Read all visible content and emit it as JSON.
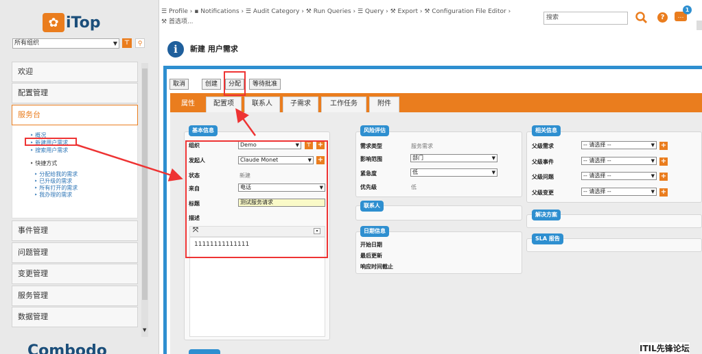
{
  "app": {
    "logo_text": "iTop",
    "vendor_text": "Combodo"
  },
  "left": {
    "org_select": "所有组织",
    "menus": [
      "欢迎",
      "配置管理",
      "服务台",
      "事件管理",
      "问题管理",
      "变更管理",
      "服务管理",
      "数据管理"
    ],
    "servicedesk_items": [
      "概况",
      "新建用户需求",
      "搜索用户需求"
    ],
    "shortcuts_label": "快捷方式",
    "shortcut_items": [
      "分配给我的需求",
      "已升级的需求",
      "所有打开的需求",
      "我办理的需求"
    ]
  },
  "topbar": {
    "breadcrumbs": [
      "Profile",
      "Notifications",
      "Audit Category",
      "Run Queries",
      "Query",
      "Export",
      "Configuration File Editor",
      "首选项..."
    ],
    "search_placeholder": "搜索",
    "notification_count": "1"
  },
  "page": {
    "title": "新建 用户需求"
  },
  "toolbar": {
    "buttons": [
      "取消",
      "创建",
      "分配",
      "等待批准"
    ]
  },
  "tabs": [
    "属性",
    "配置项",
    "联系人",
    "子需求",
    "工作任务",
    "附件"
  ],
  "basic_info": {
    "title": "基本信息",
    "fields": {
      "org": {
        "label": "组织",
        "value": "Demo"
      },
      "caller": {
        "label": "发起人",
        "value": "Claude Monet"
      },
      "status": {
        "label": "状态",
        "value": "新建"
      },
      "origin": {
        "label": "来自",
        "value": "电话"
      },
      "subject": {
        "label": "标题",
        "value": "测试服务请求"
      },
      "description": {
        "label": "描述",
        "value": "11111111111111"
      }
    }
  },
  "risk": {
    "title": "风险评估",
    "fields": [
      {
        "label": "需求类型",
        "value": "服务需求"
      },
      {
        "label": "影响范围",
        "value": "部门"
      },
      {
        "label": "紧急度",
        "value": "低"
      },
      {
        "label": "优先级",
        "value": "低"
      }
    ]
  },
  "contacts_title": "联系人",
  "dates": {
    "title": "日期信息",
    "fields": [
      "开始日期",
      "最后更新",
      "响应时间截止"
    ]
  },
  "related": {
    "title": "相关信息",
    "fields": [
      {
        "label": "父级需求",
        "value": "-- 请选择 --"
      },
      {
        "label": "父级事件",
        "value": "-- 请选择 --"
      },
      {
        "label": "父级问题",
        "value": "-- 请选择 --"
      },
      {
        "label": "父级变更",
        "value": "-- 请选择 --"
      }
    ]
  },
  "solution_title": "解决方案",
  "sla_title": "SLA 报告",
  "watermark": "ITIL先锋论坛",
  "colors": {
    "accent": "#ea7d1e",
    "blue": "#2e8fd0",
    "annotation": "#e33333"
  }
}
